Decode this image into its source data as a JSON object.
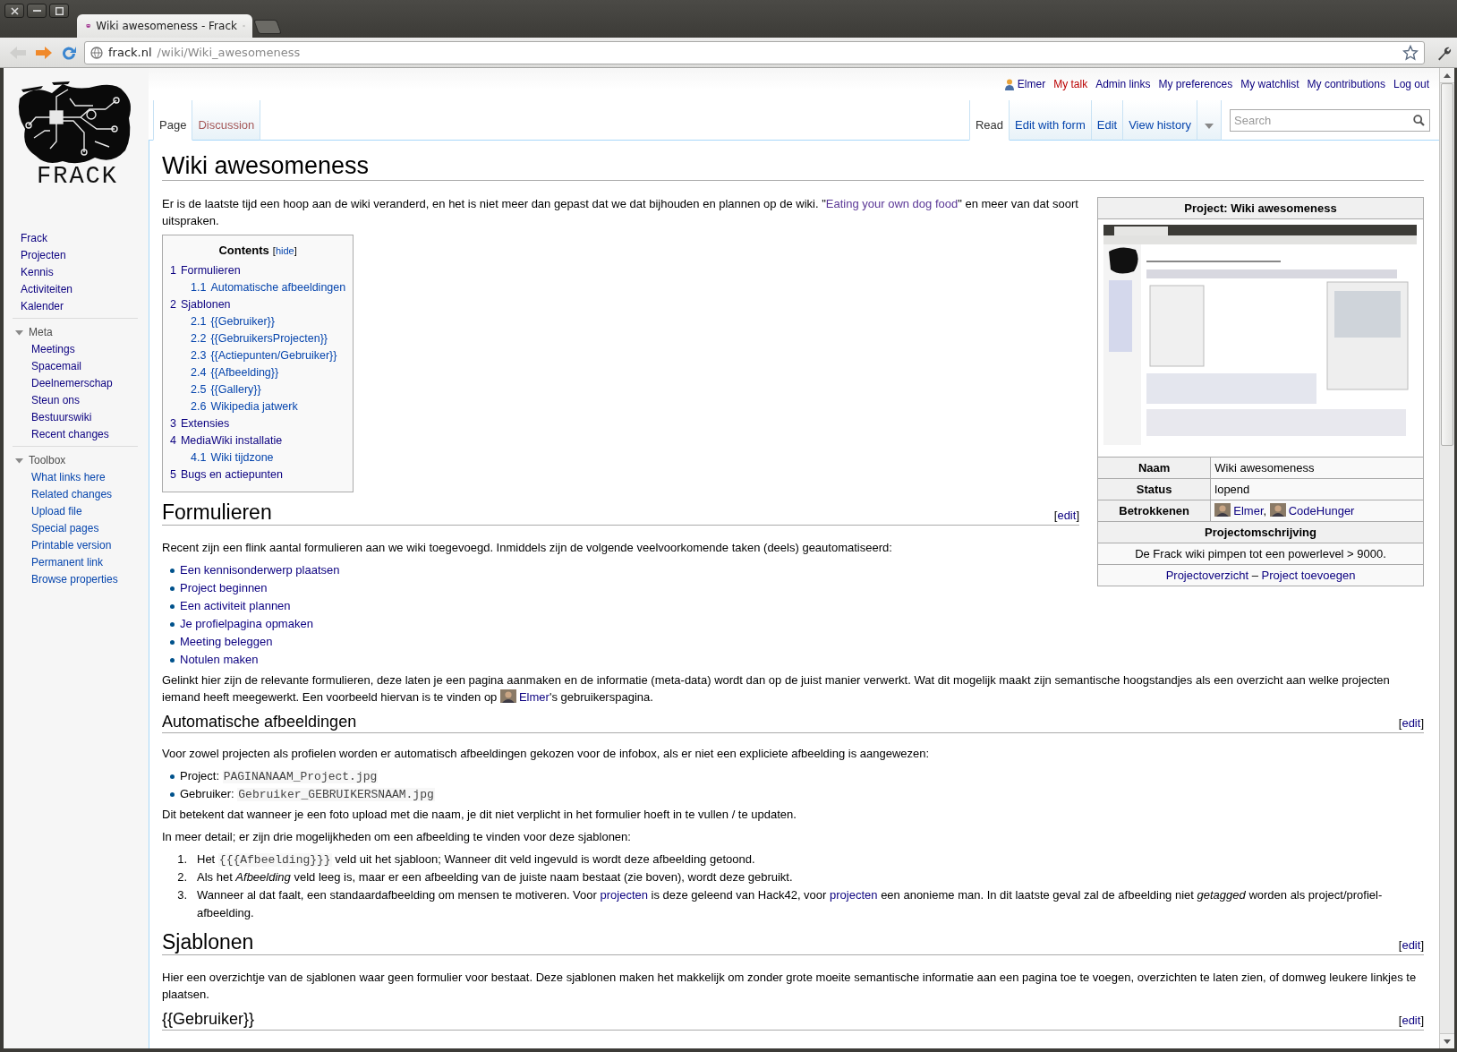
{
  "browser": {
    "tab_title": "Wiki awesomeness - Frack",
    "url_host": "frack.nl",
    "url_path": "/wiki/Wiki_awesomeness",
    "nav_buttons": [
      {
        "kind": "back",
        "disabled": true
      },
      {
        "kind": "forward",
        "disabled": false
      },
      {
        "kind": "reload",
        "disabled": false
      }
    ]
  },
  "logo": {
    "text": "FRACK"
  },
  "personal_links": [
    {
      "label": "Elmer",
      "kind": "user",
      "new": false
    },
    {
      "label": "My talk",
      "kind": "link",
      "new": true
    },
    {
      "label": "Admin links",
      "kind": "link",
      "new": false
    },
    {
      "label": "My preferences",
      "kind": "link",
      "new": false
    },
    {
      "label": "My watchlist",
      "kind": "link",
      "new": false
    },
    {
      "label": "My contributions",
      "kind": "link",
      "new": false
    },
    {
      "label": "Log out",
      "kind": "link",
      "new": false
    }
  ],
  "namespace_tabs": [
    {
      "label": "Page",
      "selected": true,
      "new": false
    },
    {
      "label": "Discussion",
      "selected": false,
      "new": true
    }
  ],
  "view_tabs": [
    {
      "label": "Read",
      "selected": true
    },
    {
      "label": "Edit with form",
      "selected": false
    },
    {
      "label": "Edit",
      "selected": false
    },
    {
      "label": "View history",
      "selected": false
    }
  ],
  "search": {
    "placeholder": "Search"
  },
  "sidebar": {
    "navigation": [
      "Frack",
      "Projecten",
      "Kennis",
      "Activiteiten",
      "Kalender"
    ],
    "portals": [
      {
        "title": "Meta",
        "expanded": true,
        "items": [
          "Meetings",
          "Spacemail",
          "Deelnemerschap",
          "Steun ons",
          "Bestuurswiki",
          "Recent changes"
        ]
      },
      {
        "title": "Toolbox",
        "expanded": true,
        "items": [
          "What links here",
          "Related changes",
          "Upload file",
          "Special pages",
          "Printable version",
          "Permanent link",
          "Browse properties"
        ]
      }
    ]
  },
  "article": {
    "title": "Wiki awesomeness",
    "infobox": {
      "title": "Project: Wiki awesomeness",
      "rows": [
        {
          "label": "Naam",
          "value": [
            {
              "kind": "text",
              "text": "Wiki awesomeness"
            }
          ]
        },
        {
          "label": "Status",
          "value": [
            {
              "kind": "text",
              "text": "lopend"
            }
          ]
        },
        {
          "label": "Betrokkenen",
          "value": [
            {
              "kind": "avatar"
            },
            {
              "kind": "link",
              "text": "Elmer"
            },
            {
              "kind": "text",
              "text": ", "
            },
            {
              "kind": "avatar"
            },
            {
              "kind": "link",
              "text": "CodeHunger"
            }
          ]
        }
      ],
      "description_heading": "Projectomschrijving",
      "description": "De Frack wiki pimpen tot een powerlevel > 9000.",
      "footer": [
        {
          "kind": "link",
          "text": "Projectoverzicht"
        },
        {
          "kind": "text",
          "text": " – "
        },
        {
          "kind": "link",
          "text": "Project toevoegen"
        }
      ]
    },
    "blocks": [
      {
        "kind": "paragraph",
        "segments": [
          {
            "kind": "text",
            "text": "Er is de laatste tijd een hoop aan de wiki veranderd, en het is niet meer dan gepast dat we dat bijhouden en plannen op de wiki. \""
          },
          {
            "kind": "visited-link",
            "text": "Eating your own dog food"
          },
          {
            "kind": "text",
            "text": "\" en meer van dat soort uitspraken."
          }
        ]
      },
      {
        "kind": "toc",
        "title": "Contents",
        "toggle": [
          "[",
          "hide",
          "]"
        ],
        "entries": [
          {
            "number": "1",
            "label": "Formulieren",
            "children": [
              {
                "number": "1.1",
                "label": "Automatische afbeeldingen"
              }
            ]
          },
          {
            "number": "2",
            "label": "Sjablonen",
            "children": [
              {
                "number": "2.1",
                "label": "{{Gebruiker}}"
              },
              {
                "number": "2.2",
                "label": "{{GebruikersProjecten}}"
              },
              {
                "number": "2.3",
                "label": "{{Actiepunten/Gebruiker}}"
              },
              {
                "number": "2.4",
                "label": "{{Afbeelding}}"
              },
              {
                "number": "2.5",
                "label": "{{Gallery}}"
              },
              {
                "number": "2.6",
                "label": "Wikipedia jatwerk"
              }
            ]
          },
          {
            "number": "3",
            "label": "Extensies"
          },
          {
            "number": "4",
            "label": "MediaWiki installatie",
            "children": [
              {
                "number": "4.1",
                "label": "Wiki tijdzone"
              }
            ]
          },
          {
            "number": "5",
            "label": "Bugs en actiepunten"
          }
        ]
      },
      {
        "kind": "section-heading",
        "text": "Formulieren",
        "edit": [
          "[",
          "edit",
          "]"
        ]
      },
      {
        "kind": "paragraph",
        "segments": [
          {
            "kind": "text",
            "text": "Recent zijn een flink aantal formulieren aan we wiki toegevoegd. Inmiddels zijn de volgende veelvoorkomende taken (deels) geautomatiseerd:"
          }
        ]
      },
      {
        "kind": "bullet-list",
        "items": [
          {
            "segments": [
              {
                "kind": "link",
                "text": "Een kennisonderwerp plaatsen"
              }
            ]
          },
          {
            "segments": [
              {
                "kind": "link",
                "text": "Project beginnen"
              }
            ]
          },
          {
            "segments": [
              {
                "kind": "link",
                "text": "Een activiteit plannen"
              }
            ]
          },
          {
            "segments": [
              {
                "kind": "link",
                "text": "Je profielpagina opmaken"
              }
            ]
          },
          {
            "segments": [
              {
                "kind": "link",
                "text": "Meeting beleggen"
              }
            ]
          },
          {
            "segments": [
              {
                "kind": "link",
                "text": "Notulen maken"
              }
            ]
          }
        ]
      },
      {
        "kind": "paragraph",
        "segments": [
          {
            "kind": "text",
            "text": "Gelinkt hier zijn de relevante formulieren, deze laten je een pagina aanmaken en de informatie (meta-data) wordt dan op de juist manier verwerkt. Wat dit mogelijk maakt zijn semantische hoogstandjes als een overzicht aan welke projecten iemand heeft meegewerkt. Een voorbeeld hiervan is te vinden op "
          },
          {
            "kind": "avatar"
          },
          {
            "kind": "link",
            "text": "Elmer"
          },
          {
            "kind": "text",
            "text": "'s gebruikerspagina."
          }
        ]
      },
      {
        "kind": "subsection-heading",
        "text": "Automatische afbeeldingen",
        "edit": [
          "[",
          "edit",
          "]"
        ]
      },
      {
        "kind": "paragraph",
        "segments": [
          {
            "kind": "text",
            "text": "Voor zowel projecten als profielen worden er automatisch afbeeldingen gekozen voor de infobox, als er niet een expliciete afbeelding is aangewezen:"
          }
        ]
      },
      {
        "kind": "bullet-list",
        "items": [
          {
            "segments": [
              {
                "kind": "text",
                "text": "Project: "
              },
              {
                "kind": "code",
                "text": "PAGINANAAM_Project.jpg"
              }
            ]
          },
          {
            "segments": [
              {
                "kind": "text",
                "text": "Gebruiker: "
              },
              {
                "kind": "code",
                "text": "Gebruiker_GEBRUIKERSNAAM.jpg"
              }
            ]
          }
        ]
      },
      {
        "kind": "paragraph",
        "segments": [
          {
            "kind": "text",
            "text": "Dit betekent dat wanneer je een foto upload met die naam, je dit niet verplicht in het formulier hoeft in te vullen / te updaten."
          }
        ]
      },
      {
        "kind": "paragraph",
        "segments": [
          {
            "kind": "text",
            "text": "In meer detail; er zijn drie mogelijkheden om een afbeelding te vinden voor deze sjablonen:"
          }
        ]
      },
      {
        "kind": "numbered-list",
        "items": [
          {
            "number": "1.",
            "segments": [
              {
                "kind": "text",
                "text": "Het "
              },
              {
                "kind": "code",
                "text": "{{{Afbeelding}}}"
              },
              {
                "kind": "text",
                "text": " veld uit het sjabloon; Wanneer dit veld ingevuld is wordt deze afbeelding getoond."
              }
            ]
          },
          {
            "number": "2.",
            "segments": [
              {
                "kind": "text",
                "text": "Als het *Afbeelding* veld leeg is, maar er een afbeelding van de juiste naam bestaat (zie boven), wordt deze gebruikt."
              }
            ]
          },
          {
            "number": "3.",
            "segments": [
              {
                "kind": "text",
                "text": "Wanneer al dat faalt, een standaardafbeelding om mensen te motiveren. Voor "
              },
              {
                "kind": "link",
                "text": "projecten"
              },
              {
                "kind": "text",
                "text": " is deze geleend van Hack42, voor "
              },
              {
                "kind": "link",
                "text": "projecten"
              },
              {
                "kind": "text",
                "text": " een anonieme man. In dit laatste geval zal de afbeelding niet *getagged* worden als project/profiel-afbeelding."
              }
            ]
          }
        ]
      },
      {
        "kind": "section-heading",
        "text": "Sjablonen",
        "edit": [
          "[",
          "edit",
          "]"
        ]
      },
      {
        "kind": "paragraph",
        "segments": [
          {
            "kind": "text",
            "text": "Hier een overzichtje van de sjablonen waar geen formulier voor bestaat. Deze sjablonen maken het makkelijk om zonder grote moeite semantische informatie aan een pagina toe te voegen, overzichten te laten zien, of domweg leukere linkjes te plaatsen."
          }
        ]
      },
      {
        "kind": "subsection-heading",
        "text": "{{Gebruiker}}",
        "edit": [
          "[",
          "edit",
          "]"
        ]
      }
    ]
  }
}
